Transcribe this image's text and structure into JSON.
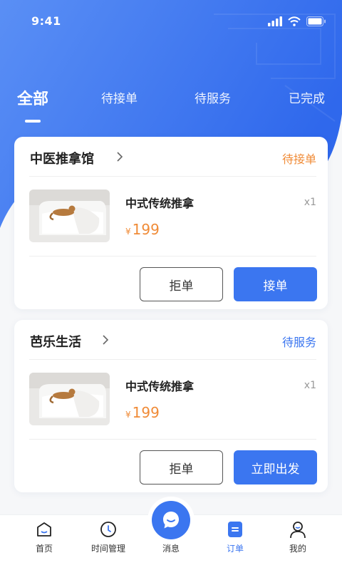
{
  "status_bar": {
    "time": "9:41"
  },
  "tabs": [
    {
      "label": "全部",
      "active": true
    },
    {
      "label": "待接单",
      "active": false
    },
    {
      "label": "待服务",
      "active": false
    },
    {
      "label": "已完成",
      "active": false
    }
  ],
  "orders": [
    {
      "shop_name": "中医推拿馆",
      "status": "待接单",
      "status_color": "#f08b37",
      "product_name": "中式传统推拿",
      "quantity": "x1",
      "currency": "¥",
      "price": "199",
      "reject_label": "拒单",
      "action_label": "接单"
    },
    {
      "shop_name": "芭乐生活",
      "status": "待服务",
      "status_color": "#3b76f0",
      "product_name": "中式传统推拿",
      "quantity": "x1",
      "currency": "¥",
      "price": "199",
      "reject_label": "拒单",
      "action_label": "立即出发"
    }
  ],
  "bottom_nav": [
    {
      "label": "首页",
      "icon": "home-icon"
    },
    {
      "label": "时间管理",
      "icon": "clock-icon"
    },
    {
      "label": "消息",
      "icon": "message-icon"
    },
    {
      "label": "订单",
      "icon": "order-icon",
      "active": true
    },
    {
      "label": "我的",
      "icon": "profile-icon"
    }
  ],
  "colors": {
    "primary": "#3b76f0",
    "pending": "#f08b37"
  }
}
